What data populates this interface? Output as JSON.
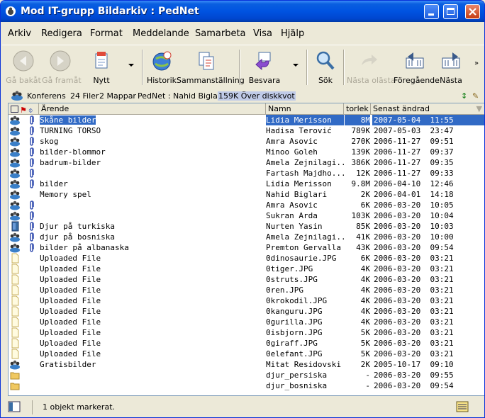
{
  "window": {
    "title": "Mod IT-grupp Bildarkiv : PedNet"
  },
  "menu": [
    "Arkiv",
    "Redigera",
    "Format",
    "Meddelande",
    "Samarbeta",
    "Visa",
    "Hjälp"
  ],
  "toolbar": {
    "back": "Gå bakåt",
    "forward": "Gå framåt",
    "new": "Nytt",
    "history": "Historik",
    "summary": "Sammanställning",
    "reply": "Besvara",
    "search": "Sök",
    "next_unread": "Nästa olästa",
    "previous": "Föregående",
    "next": "Nästa"
  },
  "infobar": {
    "conference": "Konferens",
    "files": "24 Filer",
    "folders": "2 Mappar",
    "location": "PedNet : Nahid Biglari",
    "quota": "159K Över diskkvot"
  },
  "columns": {
    "subject": "Ärende",
    "name": "Namn",
    "size": "torlek",
    "date": "Senast ändrad"
  },
  "rows": [
    {
      "icon": "conference-icon",
      "att": true,
      "subject": "Skåne bilder",
      "name": "Lidia Merisson",
      "size": "8M",
      "date": "2007-05-04  11:55",
      "selected": true
    },
    {
      "icon": "conference-icon",
      "att": true,
      "subject": "TURNING TORSO",
      "name": "Hadisa Terović",
      "size": "789K",
      "date": "2007-05-03  23:47"
    },
    {
      "icon": "conference-icon",
      "att": true,
      "subject": "skog",
      "name": "Amra Asovic",
      "size": "270K",
      "date": "2006-11-27  09:51"
    },
    {
      "icon": "conference-icon",
      "att": true,
      "subject": "bilder-blommor",
      "name": "Minoo Goleh",
      "size": "139K",
      "date": "2006-11-27  09:37"
    },
    {
      "icon": "conference-icon",
      "att": true,
      "subject": "badrum-bilder",
      "name": "Amela Zejnilagi...",
      "size": "386K",
      "date": "2006-11-27  09:35"
    },
    {
      "icon": "conference-icon",
      "att": true,
      "subject": "",
      "name": "Fartash Majdho...",
      "size": "12K",
      "date": "2006-11-27  09:33"
    },
    {
      "icon": "conference-icon",
      "att": true,
      "subject": "bilder",
      "name": "Lidia Merisson",
      "size": "9.8M",
      "date": "2006-04-10  12:46"
    },
    {
      "icon": "conference-icon",
      "att": false,
      "subject": "Memory spel",
      "name": "Nahid Biglari",
      "size": "2K",
      "date": "2006-04-01  14:18"
    },
    {
      "icon": "conference-icon",
      "att": true,
      "subject": "",
      "name": "Amra Asovic",
      "size": "6K",
      "date": "2006-03-20  10:05"
    },
    {
      "icon": "conference-icon",
      "att": true,
      "subject": "",
      "name": "Sukran Arda",
      "size": "103K",
      "date": "2006-03-20  10:04"
    },
    {
      "icon": "document-icon",
      "att": true,
      "subject": "Djur på turkiska",
      "name": "Nurten Yasin",
      "size": "85K",
      "date": "2006-03-20  10:03"
    },
    {
      "icon": "conference-icon",
      "att": true,
      "subject": "djur på bosniska",
      "name": "Amela Zejnilagi...",
      "size": "41K",
      "date": "2006-03-20  10:00"
    },
    {
      "icon": "conference-icon",
      "att": true,
      "subject": "bilder på albanaska",
      "name": "Premton Gervalla",
      "size": "43K",
      "date": "2006-03-20  09:54",
      "marker": true
    },
    {
      "icon": "file-icon",
      "att": false,
      "subject": "Uploaded File",
      "name": "0dinosaurie.JPG",
      "size": "6K",
      "date": "2006-03-20  03:21"
    },
    {
      "icon": "file-icon",
      "att": false,
      "subject": "Uploaded File",
      "name": "0tiger.JPG",
      "size": "4K",
      "date": "2006-03-20  03:21"
    },
    {
      "icon": "file-icon",
      "att": false,
      "subject": "Uploaded File",
      "name": "0struts.JPG",
      "size": "4K",
      "date": "2006-03-20  03:21"
    },
    {
      "icon": "file-icon",
      "att": false,
      "subject": "Uploaded File",
      "name": "0ren.JPG",
      "size": "4K",
      "date": "2006-03-20  03:21"
    },
    {
      "icon": "file-icon",
      "att": false,
      "subject": "Uploaded File",
      "name": "0krokodil.JPG",
      "size": "4K",
      "date": "2006-03-20  03:21"
    },
    {
      "icon": "file-icon",
      "att": false,
      "subject": "Uploaded File",
      "name": "0kanguru.JPG",
      "size": "4K",
      "date": "2006-03-20  03:21"
    },
    {
      "icon": "file-icon",
      "att": false,
      "subject": "Uploaded File",
      "name": "0gurilla.JPG",
      "size": "4K",
      "date": "2006-03-20  03:21"
    },
    {
      "icon": "file-icon",
      "att": false,
      "subject": "Uploaded File",
      "name": "0isbjorn.JPG",
      "size": "5K",
      "date": "2006-03-20  03:21"
    },
    {
      "icon": "file-icon",
      "att": false,
      "subject": "Uploaded File",
      "name": "0giraff.JPG",
      "size": "5K",
      "date": "2006-03-20  03:21"
    },
    {
      "icon": "file-icon",
      "att": false,
      "subject": "Uploaded File",
      "name": "0elefant.JPG",
      "size": "5K",
      "date": "2006-03-20  03:21"
    },
    {
      "icon": "conference-icon",
      "att": false,
      "subject": "Gratisbilder",
      "name": "Mitat Residovski",
      "size": "2K",
      "date": "2005-10-17  09:10"
    },
    {
      "icon": "folder-icon",
      "att": false,
      "subject": "",
      "name": "djur_persiska",
      "size": "-",
      "date": "2006-03-20  09:55"
    },
    {
      "icon": "folder-icon",
      "att": false,
      "subject": "",
      "name": "djur_bosniska",
      "size": "-",
      "date": "2006-03-20  09:54"
    }
  ],
  "status": {
    "text": "1 objekt markerat."
  }
}
